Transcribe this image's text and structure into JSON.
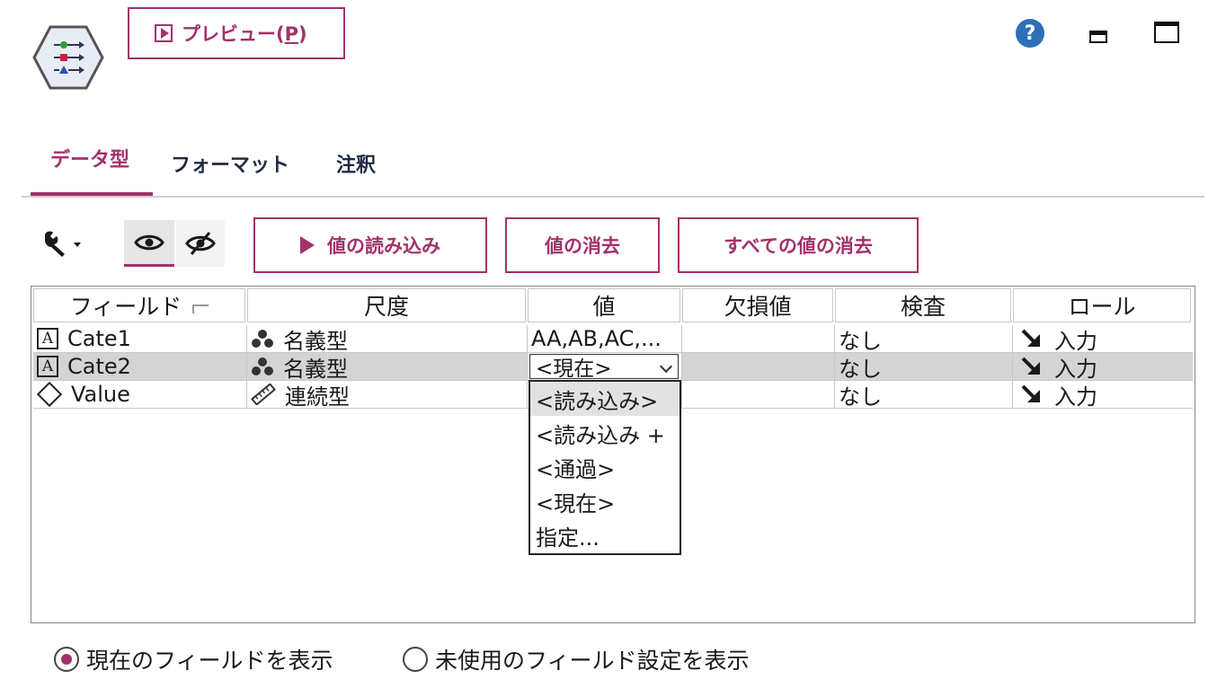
{
  "header": {
    "preview_label_main": "プレビュー(",
    "preview_mnemonic": "P",
    "preview_label_end": ")",
    "help_glyph": "?"
  },
  "tabs": [
    {
      "label": "データ型",
      "active": true
    },
    {
      "label": "フォーマット",
      "active": false
    },
    {
      "label": "注釈",
      "active": false
    }
  ],
  "toolbar": {
    "read_values": "値の読み込み",
    "clear_values": "値の消去",
    "clear_all_values": "すべての値の消去"
  },
  "table": {
    "columns": [
      "フィールド",
      "尺度",
      "値",
      "欠損値",
      "検査",
      "ロール"
    ],
    "rows": [
      {
        "field": "Cate1",
        "type_icon": "string-type-icon",
        "measure": "名義型",
        "measure_icon": "nominal-icon",
        "values": "AA,AB,AC,...",
        "missing": "",
        "check": "なし",
        "role": "入力"
      },
      {
        "field": "Cate2",
        "type_icon": "string-type-icon",
        "measure": "名義型",
        "measure_icon": "nominal-icon",
        "values": "<現在>",
        "missing": "",
        "check": "なし",
        "role": "入力"
      },
      {
        "field": "Value",
        "type_icon": "unknown-type-icon",
        "measure": "連続型",
        "measure_icon": "continuous-icon",
        "values": "",
        "missing": "",
        "check": "なし",
        "role": "入力"
      }
    ]
  },
  "values_dropdown": {
    "options": [
      "<読み込み>",
      "<読み込み +",
      "<通過>",
      "<現在>",
      "指定..."
    ],
    "highlighted_index": 0
  },
  "footer": {
    "show_current": "現在のフィールドを表示",
    "show_unused": "未使用のフィールド設定を表示",
    "selected": "show_current"
  },
  "colors": {
    "accent": "#a3316a",
    "help_blue": "#2e6fb7"
  }
}
